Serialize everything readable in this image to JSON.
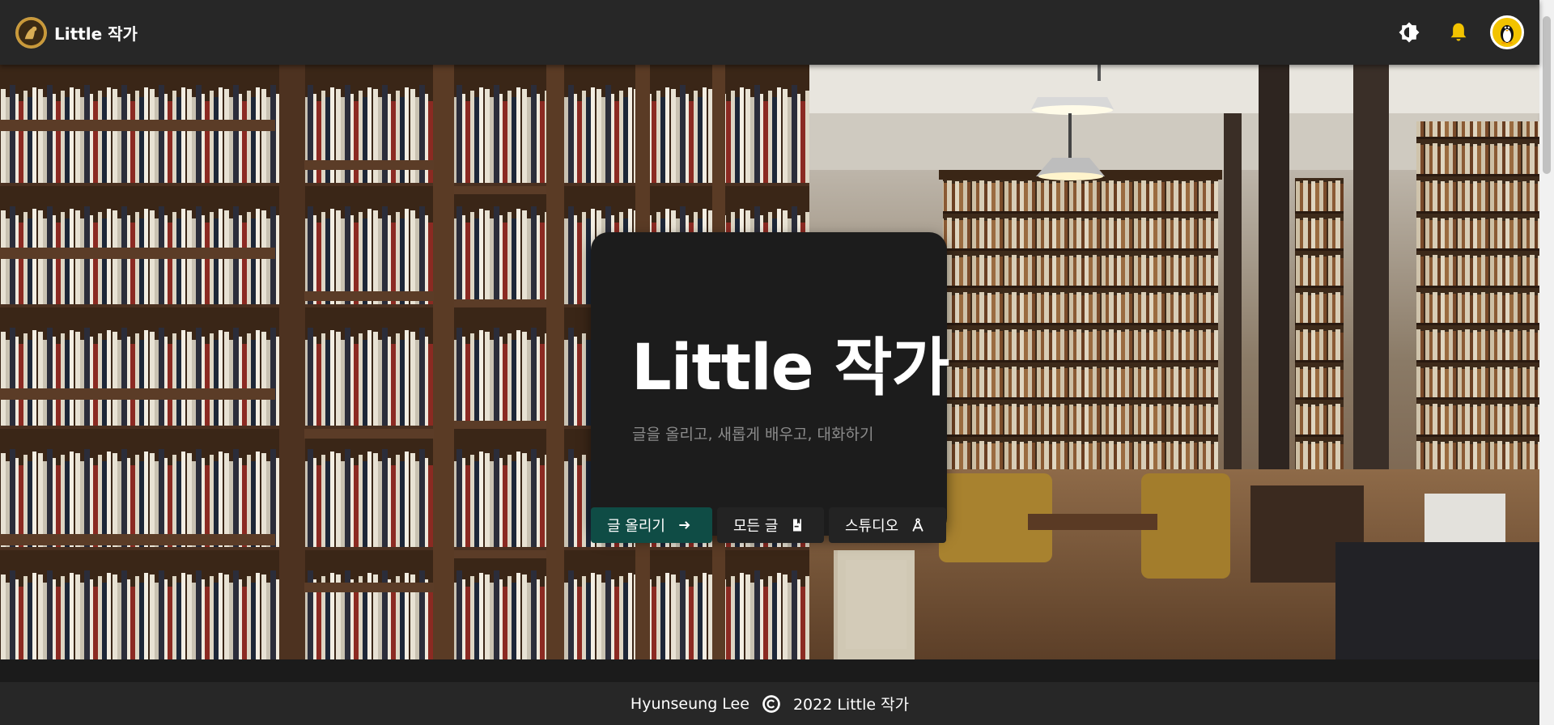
{
  "header": {
    "brand": "Little 작가",
    "theme_toggle_icon": "brightness-icon",
    "notification_icon": "bell-icon",
    "avatar_icon": "penguin-icon"
  },
  "hero": {
    "background": "library-bookshelves-photo",
    "title": "Little 작가",
    "subtitle": "글을 올리고, 새롭게 배우고, 대화하기"
  },
  "actions": {
    "post": {
      "label": "글 올리기",
      "icon": "arrow-right-icon"
    },
    "all_posts": {
      "label": "모든 글",
      "icon": "book-icon"
    },
    "studio": {
      "label": "스튜디오",
      "icon": "compass-icon"
    }
  },
  "footer": {
    "author": "Hyunseung Lee",
    "copyright": "2022 Little 작가"
  },
  "colors": {
    "navbar": "#272727",
    "card": "#1c1c1c",
    "primary_button": "#0f4c45",
    "accent_yellow": "#f2c300"
  }
}
